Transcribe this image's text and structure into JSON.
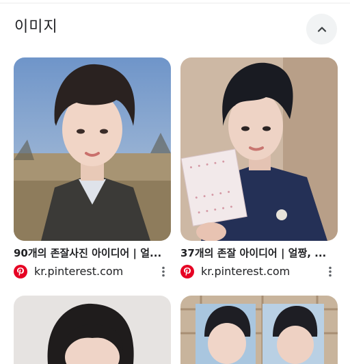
{
  "section": {
    "title": "이미지",
    "collapse_icon": "chevron-up-icon"
  },
  "results": [
    {
      "caption": "90개의 존잘사진 아이디어 | 얼...",
      "source": "kr.pinterest.com",
      "source_icon": "pinterest-icon",
      "more_icon": "more-vert-icon"
    },
    {
      "caption": "37개의 존잘 아이디어 | 얼짱, ...",
      "source": "kr.pinterest.com",
      "source_icon": "pinterest-icon",
      "more_icon": "more-vert-icon"
    }
  ],
  "colors": {
    "pinterest_red": "#e60023",
    "chip_bg": "#f1f3f4"
  }
}
